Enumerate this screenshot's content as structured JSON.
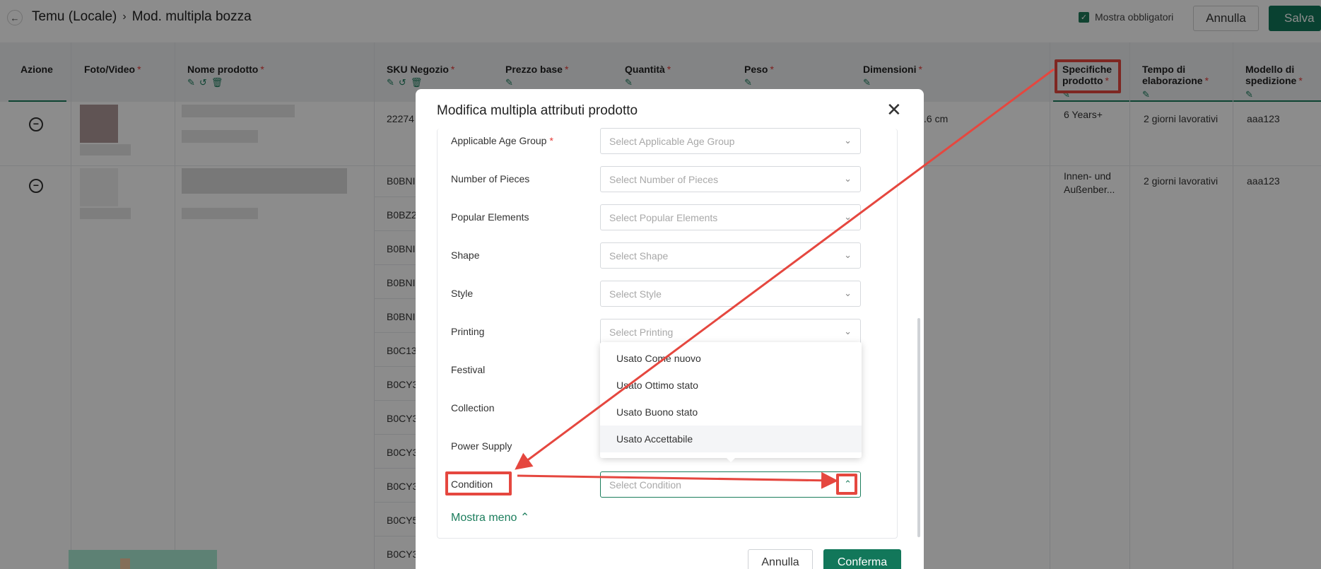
{
  "header": {
    "back_icon": "arrow-left-icon",
    "breadcrumb": [
      "Temu (Locale)",
      "Mod. multipla bozza"
    ],
    "breadcrumb_separator": "›",
    "mandatory_checkbox_label": "Mostra obbligatori",
    "mandatory_checked": true,
    "cancel_label": "Annulla",
    "save_label": "Salva"
  },
  "table": {
    "columns": [
      {
        "label": "Azione",
        "required": false
      },
      {
        "label": "Foto/Video",
        "required": true
      },
      {
        "label": "Nome prodotto",
        "required": true
      },
      {
        "label": "SKU Negozio",
        "required": true
      },
      {
        "label": "Prezzo base",
        "required": true
      },
      {
        "label": "Quantità",
        "required": true
      },
      {
        "label": "Peso",
        "required": true
      },
      {
        "label": "Dimensioni",
        "required": true
      },
      {
        "label": "Specifiche prodotto",
        "required": true
      },
      {
        "label": "Tempo di elaborazione",
        "required": true
      },
      {
        "label": "Modello di spedizione",
        "required": true
      }
    ],
    "required_mark": "*",
    "rows": [
      {
        "sku": "22274",
        "dimensions": ".6 cm",
        "specs": "6 Years+",
        "processing": "2 giorni lavorativi",
        "shipping": "aaa123"
      },
      {
        "sku": "B0BNI",
        "dimensions": "",
        "specs": "Innen- und Außenber...",
        "processing": "2 giorni lavorativi",
        "shipping": "aaa123"
      }
    ],
    "extra_skus": [
      "B0BZ2",
      "B0BNI",
      "B0BNI",
      "B0BNI",
      "B0C13",
      "B0CY3",
      "B0CY3",
      "B0CY3",
      "B0CY3",
      "B0CY5",
      "B0CY3"
    ]
  },
  "modal": {
    "title": "Modifica multipla attributi prodotto",
    "close_icon": "close-icon",
    "fields": [
      {
        "label": "Applicable Age Group",
        "required": true,
        "placeholder": "Select Applicable Age Group"
      },
      {
        "label": "Number of Pieces",
        "required": false,
        "placeholder": "Select Number of Pieces"
      },
      {
        "label": "Popular Elements",
        "required": false,
        "placeholder": "Select Popular Elements"
      },
      {
        "label": "Shape",
        "required": false,
        "placeholder": "Select Shape"
      },
      {
        "label": "Style",
        "required": false,
        "placeholder": "Select Style"
      },
      {
        "label": "Printing",
        "required": false,
        "placeholder": "Select Printing"
      },
      {
        "label": "Festival",
        "required": false,
        "placeholder": ""
      },
      {
        "label": "Collection",
        "required": false,
        "placeholder": ""
      },
      {
        "label": "Power Supply",
        "required": false,
        "placeholder": ""
      },
      {
        "label": "Condition",
        "required": false,
        "placeholder": "Select Condition"
      }
    ],
    "dropdown_options": [
      "Usato Come nuovo",
      "Usato Ottimo stato",
      "Usato Buono stato",
      "Usato Accettabile"
    ],
    "hovered_option": "Usato Accettabile",
    "show_less_label": "Mostra meno",
    "cancel_label": "Annulla",
    "confirm_label": "Conferma"
  },
  "colors": {
    "accent": "#12775a",
    "required": "#e53935",
    "annotation": "#e5473f"
  }
}
